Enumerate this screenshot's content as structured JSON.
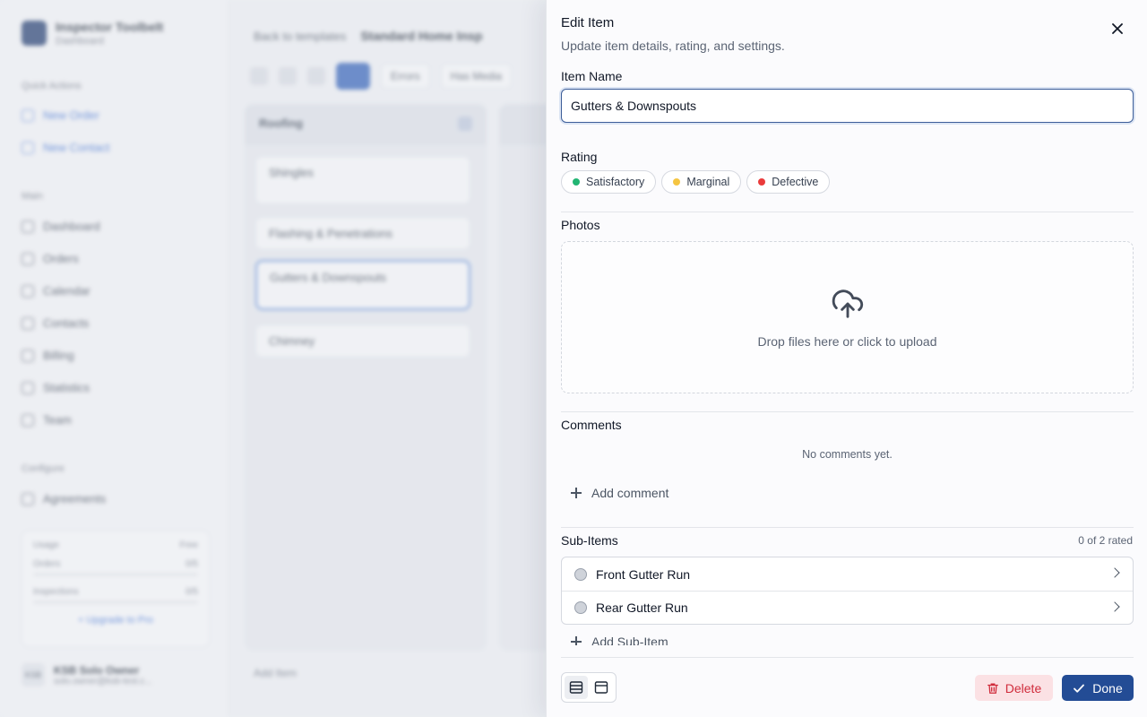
{
  "background": {
    "brand": {
      "name": "Inspector Toolbelt",
      "sub": "Dashboard"
    },
    "sidebar": {
      "quick_actions_label": "Quick Actions",
      "quick_actions": [
        "New Order",
        "New Contact"
      ],
      "main_label": "Main",
      "main_items": [
        "Dashboard",
        "Orders",
        "Calendar",
        "Contacts",
        "Billing",
        "Statistics",
        "Team"
      ],
      "configure_label": "Configure",
      "configure_items": [
        "Agreements"
      ],
      "usage": {
        "title": "Usage",
        "plan": "Free",
        "rows": [
          {
            "label": "Orders",
            "value": "0/5"
          },
          {
            "label": "Inspections",
            "value": "0/5"
          }
        ],
        "upgrade": "+ Upgrade to Pro"
      },
      "user": {
        "initials": "KSB",
        "name": "KSB Solo Owner",
        "email": "solo.owner@ksb-test.c..."
      }
    },
    "breadcrumb": {
      "back": "Back to templates",
      "title": "Standard Home Insp"
    },
    "toolbar": {
      "btn1": "Errors",
      "btn2": "Has Media"
    },
    "columns": [
      {
        "name": "Roofing",
        "cards": [
          "Shingles",
          "Flashing & Penetrations",
          "Gutters & Downspouts",
          "Chimney"
        ]
      }
    ],
    "add_item": "Add Item"
  },
  "sheet": {
    "title": "Edit Item",
    "description": "Update item details, rating, and settings.",
    "item_name_label": "Item Name",
    "item_name_value": "Gutters & Downspouts",
    "rating_label": "Rating",
    "ratings": [
      {
        "label": "Satisfactory",
        "color": "#22b573"
      },
      {
        "label": "Marginal",
        "color": "#f5c542"
      },
      {
        "label": "Defective",
        "color": "#ea3b3b"
      }
    ],
    "photos_label": "Photos",
    "dropzone_text": "Drop files here or click to upload",
    "comments_label": "Comments",
    "no_comments": "No comments yet.",
    "add_comment": "Add comment",
    "subitems_label": "Sub-Items",
    "subitems_rated": "0 of 2 rated",
    "subitems": [
      {
        "label": "Front Gutter Run"
      },
      {
        "label": "Rear Gutter Run"
      }
    ],
    "add_subitem": "Add Sub-Item",
    "delete_label": "Delete",
    "done_label": "Done",
    "colors": {
      "primary": "#234c95",
      "danger": "#d02b3b",
      "danger_bg": "#fbe1e4"
    }
  }
}
